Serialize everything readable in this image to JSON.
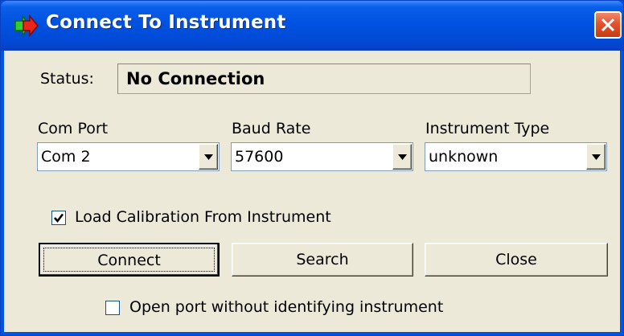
{
  "window": {
    "title": "Connect To Instrument",
    "icon": "green-red-arrows-icon",
    "close_icon": "close-icon"
  },
  "status": {
    "label": "Status:",
    "value": "No Connection"
  },
  "com_port": {
    "label": "Com Port",
    "value": "Com 2"
  },
  "baud_rate": {
    "label": "Baud Rate",
    "value": "57600"
  },
  "instrument_type": {
    "label": "Instrument Type",
    "value": "unknown"
  },
  "load_calibration": {
    "label": "Load Calibration From Instrument",
    "checked": true
  },
  "buttons": {
    "connect": "Connect",
    "search": "Search",
    "close": "Close"
  },
  "open_port_option": {
    "label": "Open port without identifying instrument",
    "checked": false
  },
  "colors": {
    "titlebar": "#0054e3",
    "dialog_bg": "#ece9d8",
    "close_button": "#e2542d"
  }
}
